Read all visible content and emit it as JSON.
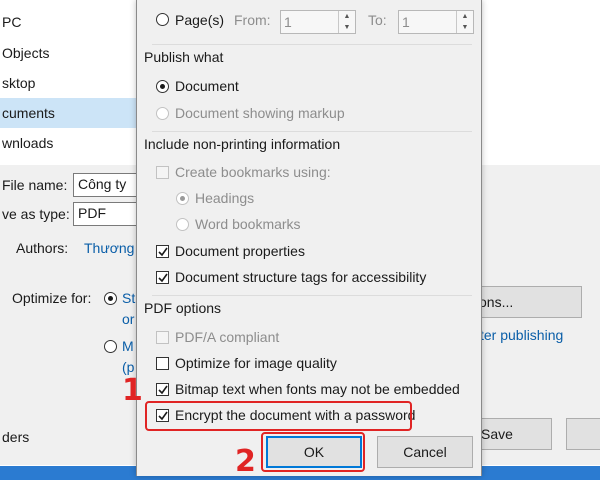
{
  "background_window": {
    "nav_items": [
      "PC",
      "Objects",
      "sktop",
      "cuments",
      "wnloads"
    ],
    "file_name_label": "File name:",
    "file_name_value": "Công ty",
    "save_type_label": "ve as type:",
    "save_type_value": "PDF",
    "authors_label": "Authors:",
    "authors_value": "Thương",
    "optimize_label": "Optimize for:",
    "optimize_option1_a": "St",
    "optimize_option1_b": "or",
    "optimize_option2_a": "M",
    "optimize_option2_b": "(p",
    "options_button": "ons...",
    "publishing_link": "ter publishing",
    "folders_label": "ders",
    "save_button": "Save"
  },
  "dialog": {
    "pages_label": "Page(s)",
    "from_label": "From:",
    "from_value": "1",
    "to_label": "To:",
    "to_value": "1",
    "publish_what_title": "Publish what",
    "document_option": "Document",
    "document_markup_option": "Document showing markup",
    "nonprinting_title": "Include non-printing information",
    "create_bookmarks": "Create bookmarks using:",
    "headings_option": "Headings",
    "word_bookmarks_option": "Word bookmarks",
    "document_properties": "Document properties",
    "structure_tags": "Document structure tags for accessibility",
    "pdf_options_title": "PDF options",
    "pdfa_compliant": "PDF/A compliant",
    "optimize_image_quality": "Optimize for image quality",
    "bitmap_text": "Bitmap text when fonts may not be embedded",
    "encrypt_password": "Encrypt the document with a password",
    "ok_button": "OK",
    "cancel_button": "Cancel"
  },
  "annotations": {
    "step1": "1",
    "step2": "2",
    "highlight_color": "#e02424"
  },
  "colors": {
    "selected_nav": "#cce4f7",
    "link": "#0a5ea8",
    "ok_border": "#0078d7",
    "taskbar": "#2b7bd1"
  }
}
